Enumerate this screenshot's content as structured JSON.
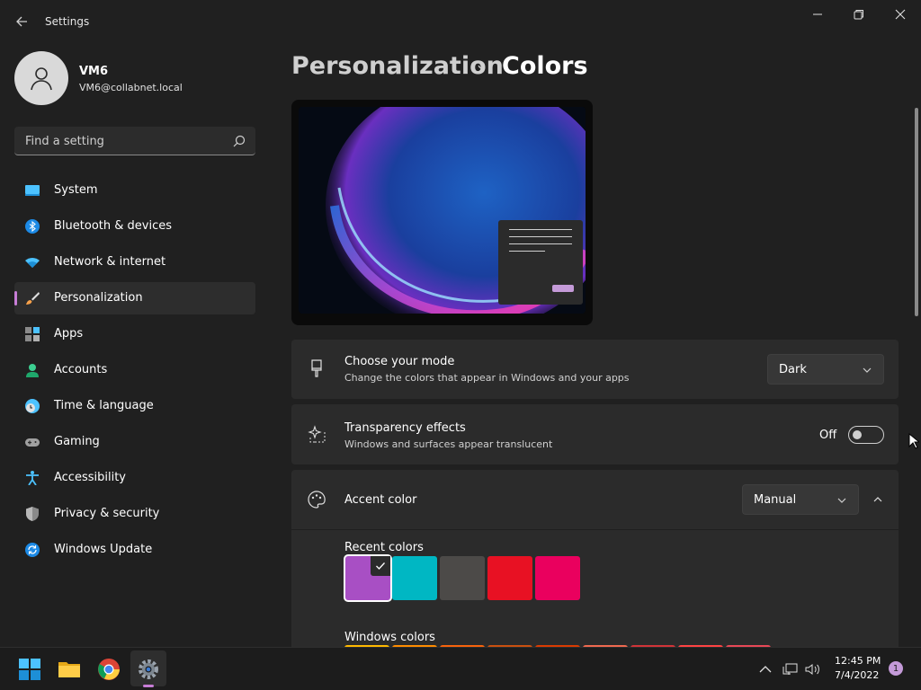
{
  "window": {
    "title": "Settings"
  },
  "user": {
    "name": "VM6",
    "email": "VM6@collabnet.local"
  },
  "search": {
    "placeholder": "Find a setting"
  },
  "sidebar": {
    "items": [
      {
        "label": "System",
        "icon": "monitor-icon"
      },
      {
        "label": "Bluetooth & devices",
        "icon": "bluetooth-icon"
      },
      {
        "label": "Network & internet",
        "icon": "wifi-icon"
      },
      {
        "label": "Personalization",
        "icon": "brush-icon",
        "selected": true
      },
      {
        "label": "Apps",
        "icon": "apps-icon"
      },
      {
        "label": "Accounts",
        "icon": "person-icon"
      },
      {
        "label": "Time & language",
        "icon": "clock-globe-icon"
      },
      {
        "label": "Gaming",
        "icon": "gamepad-icon"
      },
      {
        "label": "Accessibility",
        "icon": "accessibility-icon"
      },
      {
        "label": "Privacy & security",
        "icon": "shield-icon"
      },
      {
        "label": "Windows Update",
        "icon": "update-icon"
      }
    ]
  },
  "breadcrumb": {
    "parent": "Personalization",
    "separator": "›",
    "current": "Colors"
  },
  "mode": {
    "title": "Choose your mode",
    "subtitle": "Change the colors that appear in Windows and your apps",
    "value": "Dark"
  },
  "transparency": {
    "title": "Transparency effects",
    "subtitle": "Windows and surfaces appear translucent",
    "state": "Off"
  },
  "accent": {
    "title": "Accent color",
    "value": "Manual",
    "recent_label": "Recent colors",
    "recent_colors": [
      "#a84fc4",
      "#00b7c3",
      "#4c4a48",
      "#e81123",
      "#ea005e"
    ],
    "windows_label": "Windows colors",
    "windows_colors": [
      "#ffb900",
      "#ff8c00",
      "#f7630c",
      "#ca5010",
      "#da3b01",
      "#ef6950",
      "#d13438",
      "#ff4343",
      "#e74856"
    ]
  },
  "colors": {
    "accent": "#c77dd6",
    "background": "#202020",
    "card": "#2b2b2b"
  },
  "taskbar": {
    "time": "12:45 PM",
    "date": "7/4/2022",
    "notifications": "1"
  }
}
